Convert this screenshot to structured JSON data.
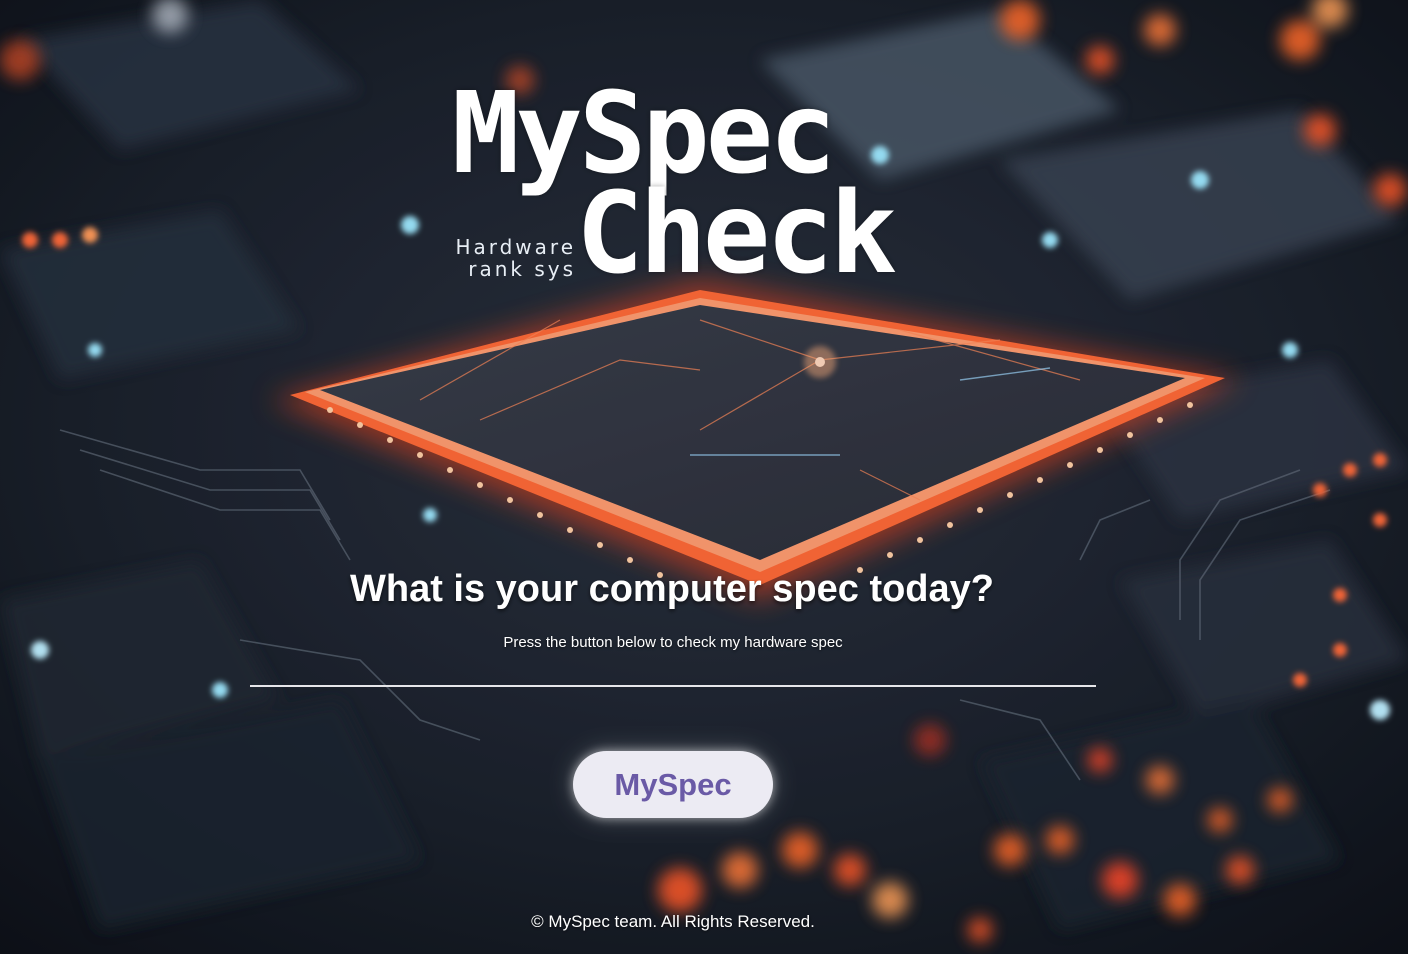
{
  "logo": {
    "line1": "MySpec",
    "line2": "Check",
    "tagline1": "Hardware",
    "tagline2": "rank sys"
  },
  "hero": {
    "headline": "What is your computer spec today?",
    "subtext": "Press the button below to check my hardware spec"
  },
  "action": {
    "button_label": "MySpec"
  },
  "footer": {
    "copyright": "© MySpec team. All Rights Reserved."
  },
  "colors": {
    "button_text": "#6a5aa6",
    "button_bg": "#ecebf3",
    "glow": "#ff5a2a",
    "board": "#1b2230"
  },
  "icons": {
    "background": "circuit-board-cpu-image"
  }
}
